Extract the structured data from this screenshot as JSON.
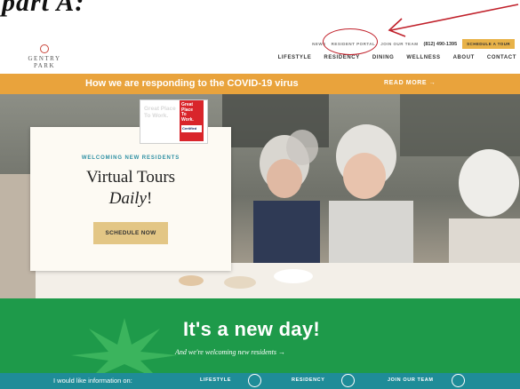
{
  "annotation": {
    "text": "part A:"
  },
  "header": {
    "logo": "GENTRY PARK",
    "utility_links": [
      "NEWS",
      "RESIDENT PORTAL",
      "JOIN OUR TEAM"
    ],
    "phone": "(812) 490-1395",
    "cta": "SCHEDULE A TOUR",
    "nav": [
      "LIFESTYLE",
      "RESIDENCY",
      "DINING",
      "WELLNESS",
      "ABOUT",
      "CONTACT"
    ]
  },
  "covid_banner": {
    "text": "How we are responding to the COVID-19 virus",
    "link": "READ MORE →"
  },
  "hero": {
    "kicker": "WELCOMING NEW RESIDENTS",
    "title": "Virtual Tours",
    "subtitle": "Daily",
    "subtitle_bang": "!",
    "button": "SCHEDULE NOW",
    "badge_ghost": "Great Place To Work.",
    "badge": [
      "Great",
      "Place",
      "To",
      "Work."
    ],
    "badge_certified": "Certified"
  },
  "new_day": {
    "title": "It's a new day!",
    "subtitle": "And we're welcoming new residents →"
  },
  "info_bar": {
    "lead": "I would like information on:",
    "options": [
      "LIFESTYLE",
      "RESIDENCY",
      "JOIN OUR TEAM"
    ]
  },
  "colors": {
    "banner": "#e9a33c",
    "green": "#1e9a4a",
    "teal": "#1f8c98",
    "annotation_red": "#c0202a"
  }
}
